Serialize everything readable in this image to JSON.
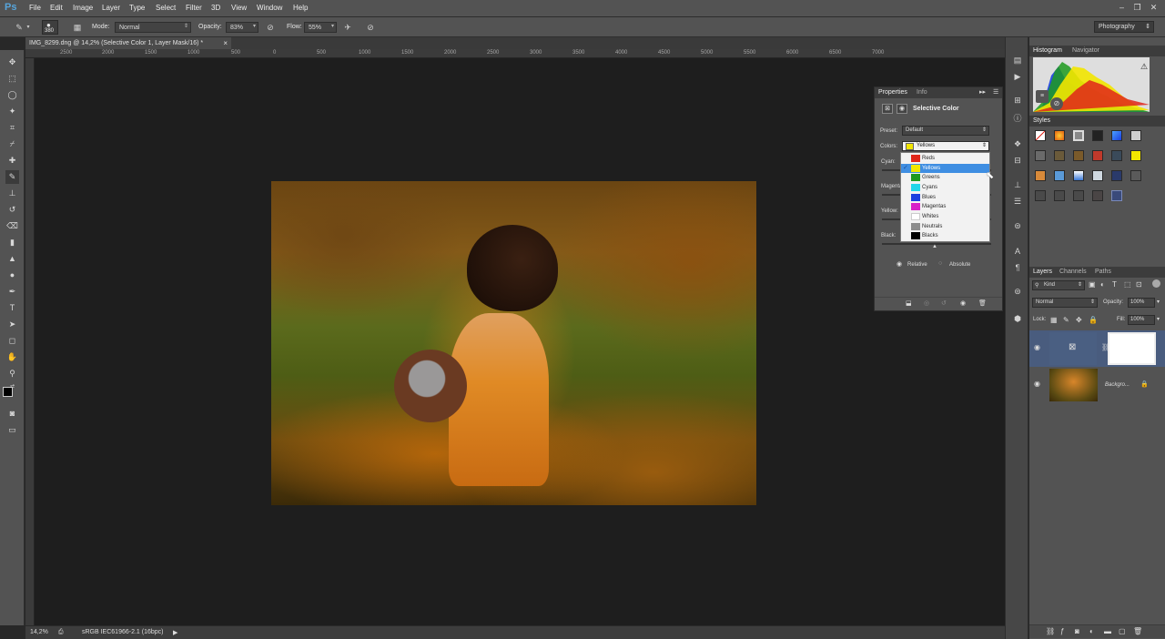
{
  "app": {
    "logo": "Ps"
  },
  "menu": [
    "File",
    "Edit",
    "Image",
    "Layer",
    "Type",
    "Select",
    "Filter",
    "3D",
    "View",
    "Window",
    "Help"
  ],
  "window_controls": {
    "minimize": "–",
    "restore": "❐",
    "close": "✕"
  },
  "options_bar": {
    "brush_size": "380",
    "mode_label": "Mode:",
    "mode_value": "Normal",
    "opacity_label": "Opacity:",
    "opacity_value": "83%",
    "flow_label": "Flow:",
    "flow_value": "55%",
    "workspace": "Photography"
  },
  "document": {
    "tab_title": "IMG_8299.dng @ 14,2% (Selective Color 1, Layer Mask/16) *",
    "close": "×"
  },
  "ruler_ticks": [
    "2500",
    "2000",
    "1500",
    "1000",
    "500",
    "0",
    "500",
    "1000",
    "1500",
    "2000",
    "2500",
    "3000",
    "3500",
    "4000",
    "4500",
    "5000",
    "5500",
    "6000",
    "6500",
    "7000"
  ],
  "status": {
    "zoom": "14,2%",
    "profile": "sRGB IEC61966-2.1 (16bpc)"
  },
  "properties_panel": {
    "tabs": [
      "Properties",
      "Info"
    ],
    "title": "Selective Color",
    "preset_label": "Preset:",
    "preset_value": "Default",
    "colors_label": "Colors:",
    "colors_value": "Yellows",
    "sliders": [
      {
        "label": "Cyan:",
        "value": ""
      },
      {
        "label": "Magenta:",
        "value": ""
      },
      {
        "label": "Yellow:",
        "value": ""
      },
      {
        "label": "Black:",
        "value": ""
      }
    ],
    "method_relative": "Relative",
    "method_absolute": "Absolute",
    "method_selected": "Relative"
  },
  "colors_dropdown": {
    "items": [
      {
        "label": "Reds",
        "color": "#e0261a"
      },
      {
        "label": "Yellows",
        "color": "#f2e600"
      },
      {
        "label": "Greens",
        "color": "#1f9a1f"
      },
      {
        "label": "Cyans",
        "color": "#22d6e8"
      },
      {
        "label": "Blues",
        "color": "#1a3fe0"
      },
      {
        "label": "Magentas",
        "color": "#d81fc8"
      },
      {
        "label": "Whites",
        "color": "#ffffff"
      },
      {
        "label": "Neutrals",
        "color": "#8c8c8c"
      },
      {
        "label": "Blacks",
        "color": "#000000"
      }
    ],
    "selected": "Yellows"
  },
  "histogram_panel": {
    "tabs": [
      "Histogram",
      "Navigator"
    ],
    "warning": "⚠"
  },
  "styles_panel": {
    "title": "Styles"
  },
  "layers_panel": {
    "tabs": [
      "Layers",
      "Channels",
      "Paths"
    ],
    "filter_value": "Kind",
    "blend_mode": "Normal",
    "opacity_label": "Opacity:",
    "opacity_value": "100%",
    "lock_label": "Lock:",
    "fill_label": "Fill:",
    "fill_value": "100%",
    "layers": [
      {
        "name": "",
        "type": "adjustment",
        "visible": true,
        "selected": true
      },
      {
        "name": "Backgro...",
        "type": "image",
        "visible": true,
        "selected": false
      }
    ]
  },
  "accent_colors": {
    "selection": "#3f8ee2",
    "panel": "#535353",
    "dark": "#282828"
  }
}
